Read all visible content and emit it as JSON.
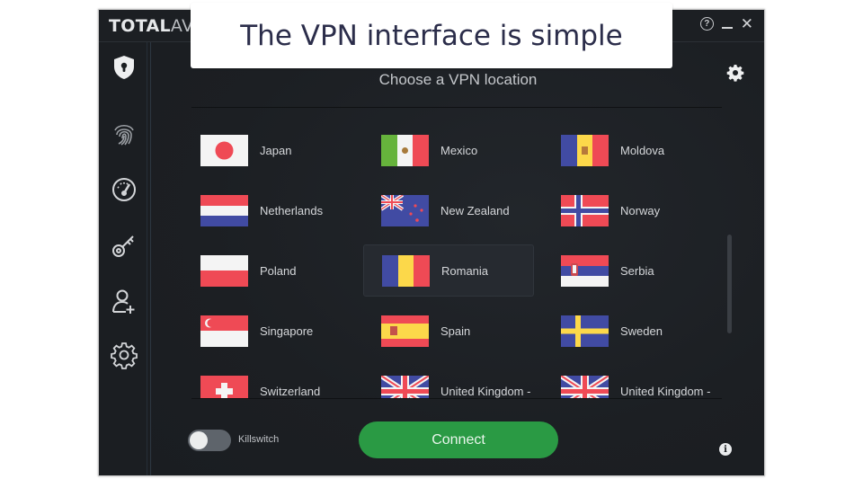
{
  "caption": "The VPN interface is simple",
  "window": {
    "brand_total": "TOTAL",
    "brand_av": "AV",
    "controls": {
      "help": "?",
      "minimize": "minimize",
      "close": "✕"
    }
  },
  "sidebar": {
    "items": [
      {
        "name": "vpn-shield",
        "icon": "shield-lock-icon"
      },
      {
        "name": "fingerprint",
        "icon": "fingerprint-icon"
      },
      {
        "name": "speed",
        "icon": "speedometer-icon"
      },
      {
        "name": "password",
        "icon": "key-icon"
      },
      {
        "name": "add-user",
        "icon": "user-plus-icon"
      },
      {
        "name": "settings",
        "icon": "gear-icon"
      }
    ]
  },
  "main": {
    "title": "Choose a VPN location",
    "locations": [
      {
        "name": "",
        "flag": "partial-red"
      },
      {
        "name": "",
        "flag": "partial-blue"
      },
      {
        "name": "",
        "flag": "partial-italy"
      },
      {
        "name": "Japan",
        "flag": "jp"
      },
      {
        "name": "Mexico",
        "flag": "mx"
      },
      {
        "name": "Moldova",
        "flag": "md"
      },
      {
        "name": "Netherlands",
        "flag": "nl"
      },
      {
        "name": "New Zealand",
        "flag": "nz"
      },
      {
        "name": "Norway",
        "flag": "no"
      },
      {
        "name": "Poland",
        "flag": "pl"
      },
      {
        "name": "Romania",
        "flag": "ro",
        "selected": true
      },
      {
        "name": "Serbia",
        "flag": "rs"
      },
      {
        "name": "Singapore",
        "flag": "sg"
      },
      {
        "name": "Spain",
        "flag": "es"
      },
      {
        "name": "Sweden",
        "flag": "se"
      },
      {
        "name": "Switzerland",
        "flag": "ch"
      },
      {
        "name": "United Kingdom -",
        "flag": "gb"
      },
      {
        "name": "United Kingdom -",
        "flag": "gb"
      }
    ],
    "killswitch_label": "Killswitch",
    "killswitch_on": false,
    "connect_label": "Connect",
    "info": "i"
  },
  "colors": {
    "background": "#1c1f23",
    "connect": "#2a9a44",
    "flag_red": "#ef4a55",
    "flag_blue": "#414ba3",
    "flag_white": "#f4f4f4",
    "flag_yellow": "#fcd84a",
    "flag_green": "#66b33c"
  }
}
